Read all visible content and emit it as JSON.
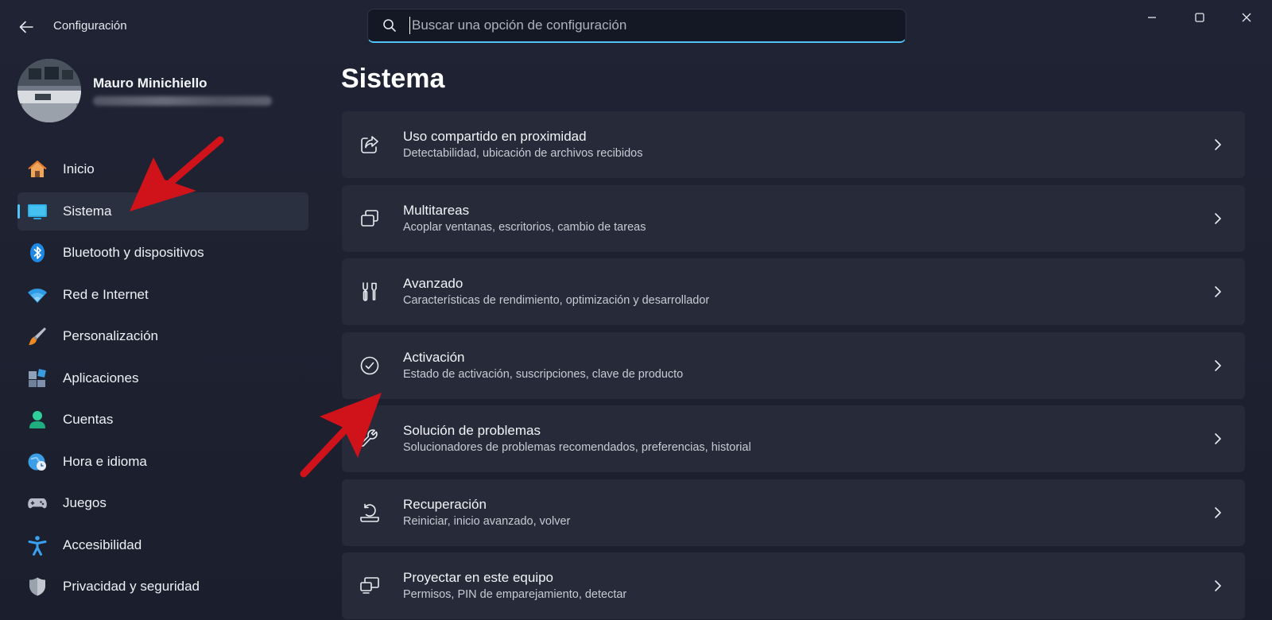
{
  "window": {
    "title": "Configuración",
    "controls": [
      "minimize",
      "maximize",
      "close"
    ]
  },
  "search": {
    "placeholder": "Buscar una opción de configuración",
    "value": ""
  },
  "user": {
    "name": "Mauro Minichiello"
  },
  "sidebar": {
    "items": [
      {
        "label": "Inicio",
        "icon": "home-icon"
      },
      {
        "label": "Sistema",
        "icon": "monitor-icon",
        "active": true
      },
      {
        "label": "Bluetooth y dispositivos",
        "icon": "bluetooth-icon"
      },
      {
        "label": "Red e Internet",
        "icon": "wifi-icon"
      },
      {
        "label": "Personalización",
        "icon": "brush-icon"
      },
      {
        "label": "Aplicaciones",
        "icon": "apps-icon"
      },
      {
        "label": "Cuentas",
        "icon": "person-icon"
      },
      {
        "label": "Hora e idioma",
        "icon": "globe-clock-icon"
      },
      {
        "label": "Juegos",
        "icon": "gamepad-icon"
      },
      {
        "label": "Accesibilidad",
        "icon": "accessibility-icon"
      },
      {
        "label": "Privacidad y seguridad",
        "icon": "shield-icon"
      }
    ]
  },
  "main": {
    "title": "Sistema",
    "cards": [
      {
        "title": "Uso compartido en proximidad",
        "subtitle": "Detectabilidad, ubicación de archivos recibidos",
        "icon": "share-icon"
      },
      {
        "title": "Multitareas",
        "subtitle": "Acoplar ventanas, escritorios, cambio de tareas",
        "icon": "multitask-icon"
      },
      {
        "title": "Avanzado",
        "subtitle": "Características de rendimiento, optimización y desarrollador",
        "icon": "tools-icon"
      },
      {
        "title": "Activación",
        "subtitle": "Estado de activación, suscripciones, clave de producto",
        "icon": "check-circle-icon"
      },
      {
        "title": "Solución de problemas",
        "subtitle": "Solucionadores de problemas recomendados, preferencias, historial",
        "icon": "wrench-icon"
      },
      {
        "title": "Recuperación",
        "subtitle": "Reiniciar, inicio avanzado, volver",
        "icon": "recovery-icon"
      },
      {
        "title": "Proyectar en este equipo",
        "subtitle": "Permisos, PIN de emparejamiento, detectar",
        "icon": "project-icon"
      }
    ]
  },
  "colors": {
    "accent": "#4fc3f7",
    "background": "#1c2130",
    "card": "#262a39",
    "annotation_arrow": "#d0121b"
  }
}
